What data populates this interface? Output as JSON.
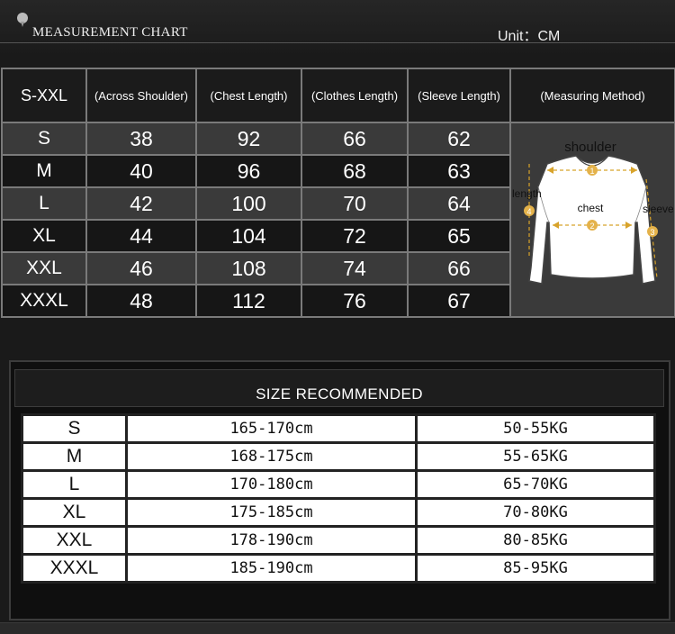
{
  "header": {
    "title": "MEASUREMENT CHART",
    "unit": "Unit：CM"
  },
  "measurement": {
    "headers": [
      "S-XXL",
      "(Across Shoulder)",
      "(Chest Length)",
      "(Clothes Length)",
      "(Sleeve Length)",
      "(Measuring Method)"
    ],
    "rows": [
      [
        "S",
        "38",
        "92",
        "66",
        "62"
      ],
      [
        "M",
        "40",
        "96",
        "68",
        "63"
      ],
      [
        "L",
        "42",
        "100",
        "70",
        "64"
      ],
      [
        "XL",
        "44",
        "104",
        "72",
        "65"
      ],
      [
        "XXL",
        "46",
        "108",
        "74",
        "66"
      ],
      [
        "XXXL",
        "48",
        "112",
        "76",
        "67"
      ]
    ],
    "diagram": {
      "shoulder": "shoulder",
      "length": "length",
      "chest": "chest",
      "sleeve": "sleeve",
      "markers": [
        "1",
        "2",
        "3",
        "4"
      ]
    }
  },
  "recommended": {
    "title": "SIZE RECOMMENDED",
    "rows": [
      [
        "S",
        "165-170cm",
        "50-55KG"
      ],
      [
        "M",
        "168-175cm",
        "55-65KG"
      ],
      [
        "L",
        "170-180cm",
        "65-70KG"
      ],
      [
        "XL",
        "175-185cm",
        "70-80KG"
      ],
      [
        "XXL",
        "178-190cm",
        "80-85KG"
      ],
      [
        "XXXL",
        "185-190cm",
        "85-95KG"
      ]
    ]
  }
}
